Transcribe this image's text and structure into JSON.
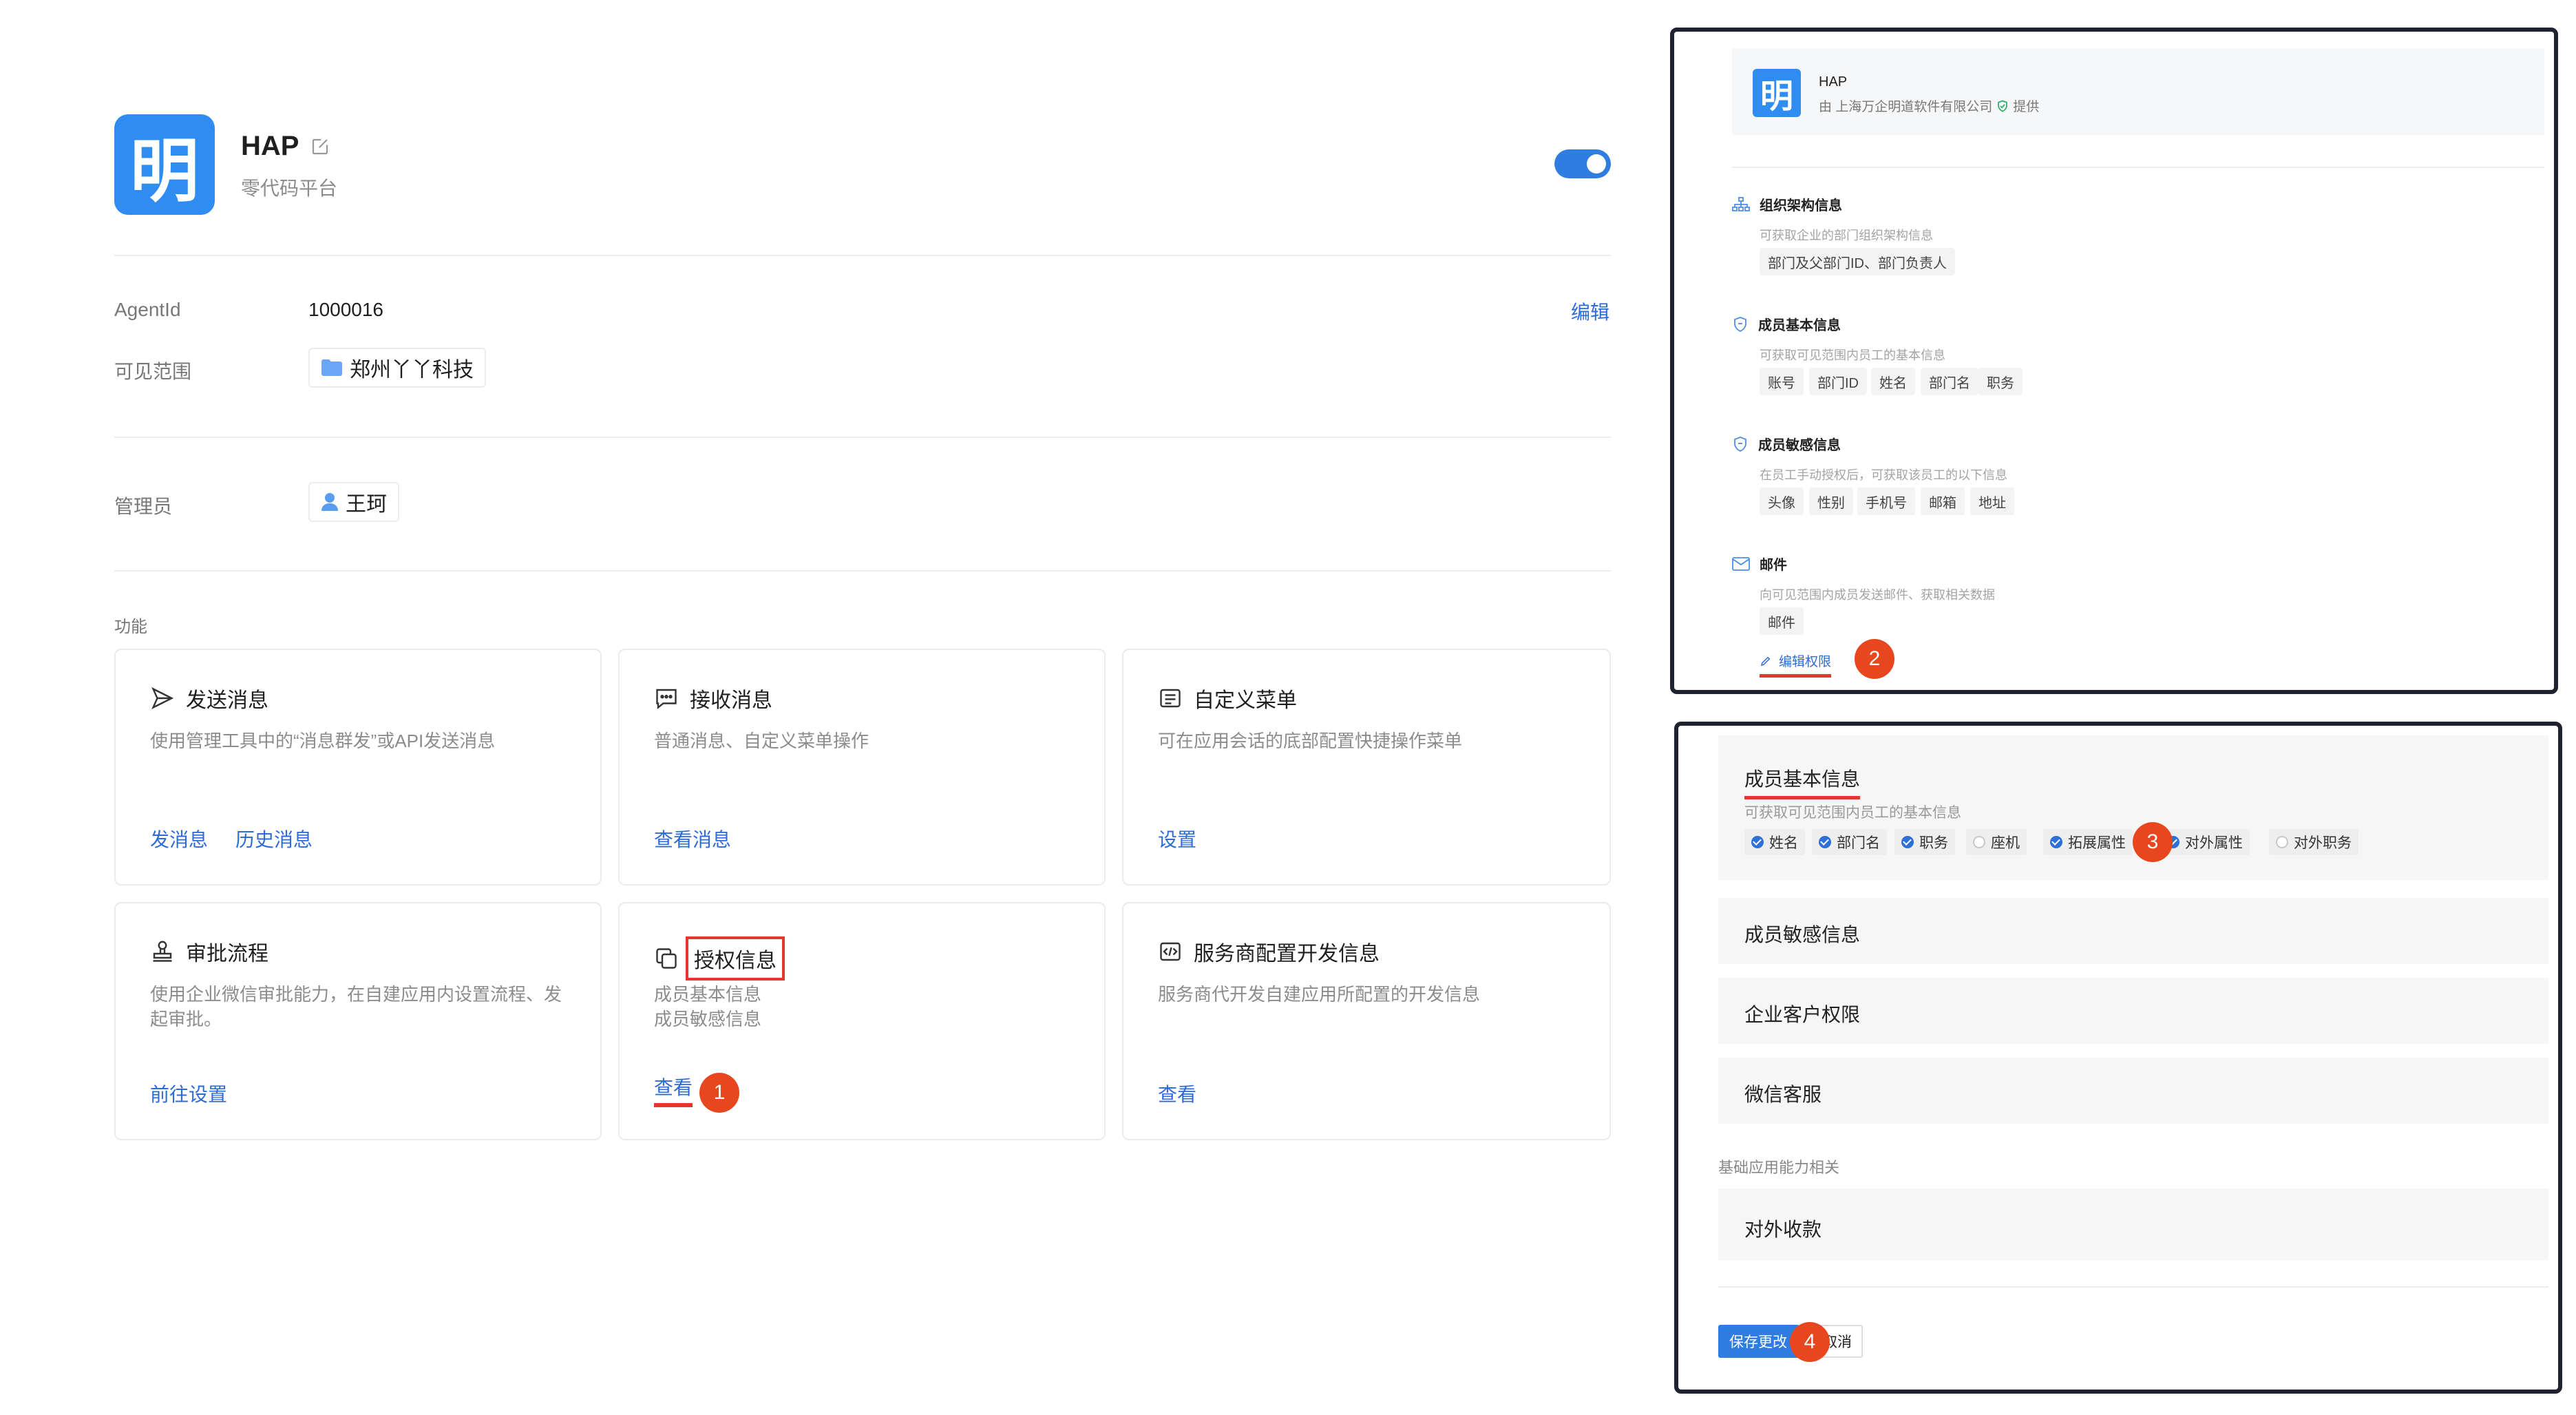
{
  "app": {
    "logo_char": "明",
    "name": "HAP",
    "subtitle": "零代码平台",
    "enabled": true
  },
  "info": {
    "agentid_label": "AgentId",
    "agentid_value": "1000016",
    "edit_label": "编辑",
    "visible_label": "可见范围",
    "visible_value": "郑州丫丫科技",
    "admin_label": "管理员",
    "admin_value": "王珂"
  },
  "features": {
    "section_label": "功能",
    "cards": [
      {
        "title": "发送消息",
        "desc": "使用管理工具中的“消息群发”或API发送消息",
        "links": [
          "发消息",
          "历史消息"
        ],
        "icon": "send-icon"
      },
      {
        "title": "接收消息",
        "desc": "普通消息、自定义菜单操作",
        "links": [
          "查看消息"
        ],
        "icon": "chat-icon"
      },
      {
        "title": "自定义菜单",
        "desc": "可在应用会话的底部配置快捷操作菜单",
        "links": [
          "设置"
        ],
        "icon": "menu-icon"
      },
      {
        "title": "审批流程",
        "desc_lines": [
          "使用企业微信审批能力，在自建应用内设置流程、发",
          "起审批。"
        ],
        "links": [
          "前往设置"
        ],
        "icon": "stamp-icon"
      },
      {
        "title": "授权信息",
        "desc_lines": [
          "成员基本信息",
          "成员敏感信息"
        ],
        "links": [
          "查看"
        ],
        "icon": "copy-icon"
      },
      {
        "title": "服务商配置开发信息",
        "desc": "服务商代开发自建应用所配置的开发信息",
        "links": [
          "查看"
        ],
        "icon": "code-icon"
      }
    ]
  },
  "auth_panel": {
    "app_name": "HAP",
    "provider": "由 上海万企明道软件有限公司",
    "provider_suffix": "提供",
    "sections": [
      {
        "title": "组织架构信息",
        "desc": "可获取企业的部门组织架构信息",
        "tags": [
          "部门及父部门ID、部门负责人"
        ],
        "icon": "org-icon"
      },
      {
        "title": "成员基本信息",
        "desc": "可获取可见范围内员工的基本信息",
        "tags": [
          "账号",
          "部门ID",
          "姓名",
          "部门名",
          "职务"
        ],
        "icon": "shield-icon"
      },
      {
        "title": "成员敏感信息",
        "desc": "在员工手动授权后，可获取该员工的以下信息",
        "tags": [
          "头像",
          "性别",
          "手机号",
          "邮箱",
          "地址"
        ],
        "icon": "shield-icon"
      },
      {
        "title": "邮件",
        "desc": "向可见范围内成员发送邮件、获取相关数据",
        "tags": [
          "邮件"
        ],
        "icon": "mail-icon"
      }
    ],
    "edit_permission": "编辑权限"
  },
  "edit_panel": {
    "basic_title": "成员基本信息",
    "basic_desc": "可获取可见范围内员工的基本信息",
    "options": [
      {
        "label": "姓名",
        "checked": true
      },
      {
        "label": "部门名",
        "checked": true
      },
      {
        "label": "职务",
        "checked": true
      },
      {
        "label": "座机",
        "checked": false
      },
      {
        "label": "拓展属性",
        "checked": true
      },
      {
        "label": "对外属性",
        "checked": true
      },
      {
        "label": "对外职务",
        "checked": false
      }
    ],
    "rows": [
      "成员敏感信息",
      "企业客户权限",
      "微信客服"
    ],
    "group_label": "基础应用能力相关",
    "group_rows": [
      "对外收款"
    ],
    "save_label": "保存更改",
    "cancel_label": "取消"
  },
  "steps": [
    "1",
    "2",
    "3",
    "4"
  ]
}
